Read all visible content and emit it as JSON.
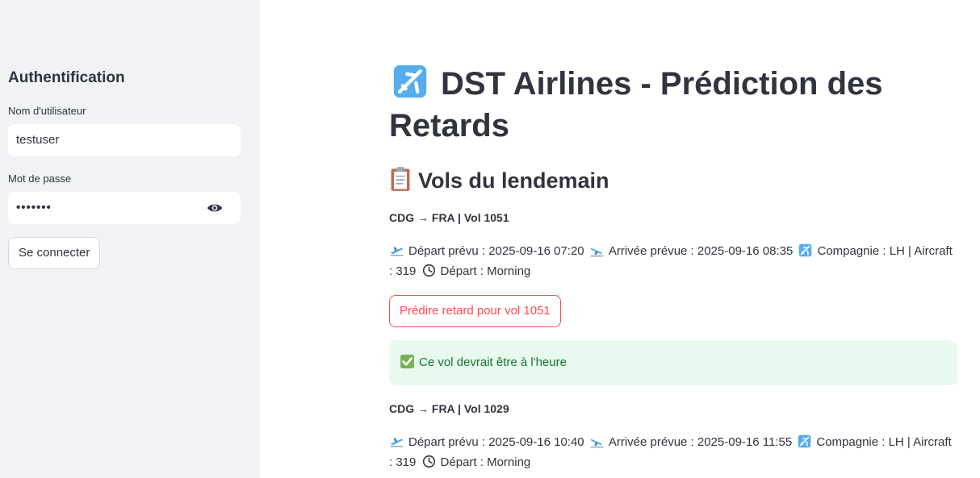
{
  "sidebar": {
    "title": "Authentification",
    "username_label": "Nom d'utilisateur",
    "username_value": "testuser",
    "password_label": "Mot de passe",
    "password_value": "•••••••",
    "login_button": "Se connecter"
  },
  "main": {
    "title": "DST Airlines - Prédiction des Retards",
    "section_title": "Vols du lendemain",
    "flights": [
      {
        "header": "CDG → FRA | Vol 1051",
        "depart": "Départ prévu : 2025-09-16 07:20",
        "arrivee": "Arrivée prévue : 2025-09-16 08:35",
        "compagnie": "Compagnie : LH | Aircraft : 319",
        "period": "Départ : Morning",
        "predict_button": "Prédire retard pour vol 1051",
        "result": "Ce vol devrait être à l'heure"
      },
      {
        "header": "CDG → FRA | Vol 1029",
        "depart": "Départ prévu : 2025-09-16 10:40",
        "arrivee": "Arrivée prévue : 2025-09-16 11:55",
        "compagnie": "Compagnie : LH | Aircraft : 319",
        "period": "Départ : Morning"
      }
    ]
  },
  "icons": {
    "title": "airplane-icon",
    "section": "clipboard-icon",
    "depart": "departure-icon",
    "arrivee": "arrival-icon",
    "compagnie": "airplane-icon",
    "period": "clock-icon",
    "result": "check-mark-icon",
    "password": "eye-icon"
  },
  "colors": {
    "sidebar_bg": "#f0f2f6",
    "primary_red": "#ff4b4b",
    "success_bg": "#e8f9ee",
    "success_text": "#177233"
  }
}
